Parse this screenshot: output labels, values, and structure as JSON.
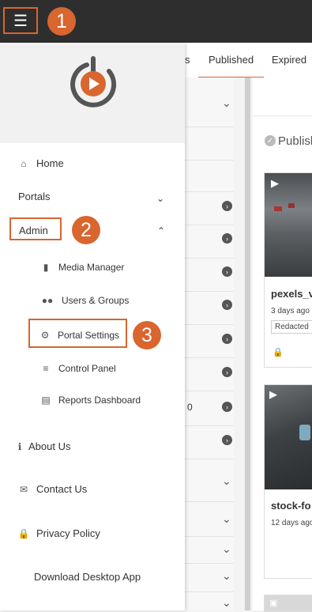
{
  "topbar": {
    "menu_icon": "hamburger-icon"
  },
  "callouts": [
    "1",
    "2",
    "3"
  ],
  "tabs": [
    {
      "label": "s",
      "active": false
    },
    {
      "label": "Published",
      "active": true
    },
    {
      "label": "Expired",
      "active": false
    }
  ],
  "background": {
    "middle_fragment": "0",
    "section_title": "Publish",
    "cards": [
      {
        "title": "pexels_v",
        "date": "3 days ago",
        "tag": "Redacted"
      },
      {
        "title": "stock-fo",
        "date": "12 days ago"
      }
    ]
  },
  "drawer": {
    "items": [
      {
        "label": "Home",
        "icon": "home-icon"
      },
      {
        "label": "Portals",
        "icon": "",
        "caret": "chevron-down-icon"
      },
      {
        "label": "Admin",
        "icon": "",
        "caret": "chevron-up-icon"
      },
      {
        "label": "Media Manager",
        "icon": "folder-icon"
      },
      {
        "label": "Users & Groups",
        "icon": "users-icon"
      },
      {
        "label": "Portal Settings",
        "icon": "gear-icon"
      },
      {
        "label": "Control Panel",
        "icon": "checklist-icon"
      },
      {
        "label": "Reports Dashboard",
        "icon": "chart-icon"
      },
      {
        "label": "About Us",
        "icon": "info-icon"
      },
      {
        "label": "Contact Us",
        "icon": "envelope-icon"
      },
      {
        "label": "Privacy Policy",
        "icon": "lock-icon"
      },
      {
        "label": "Download Desktop App",
        "icon": ""
      }
    ]
  },
  "colors": {
    "accent": "#d9652f",
    "topbar": "#2e2e2e"
  }
}
